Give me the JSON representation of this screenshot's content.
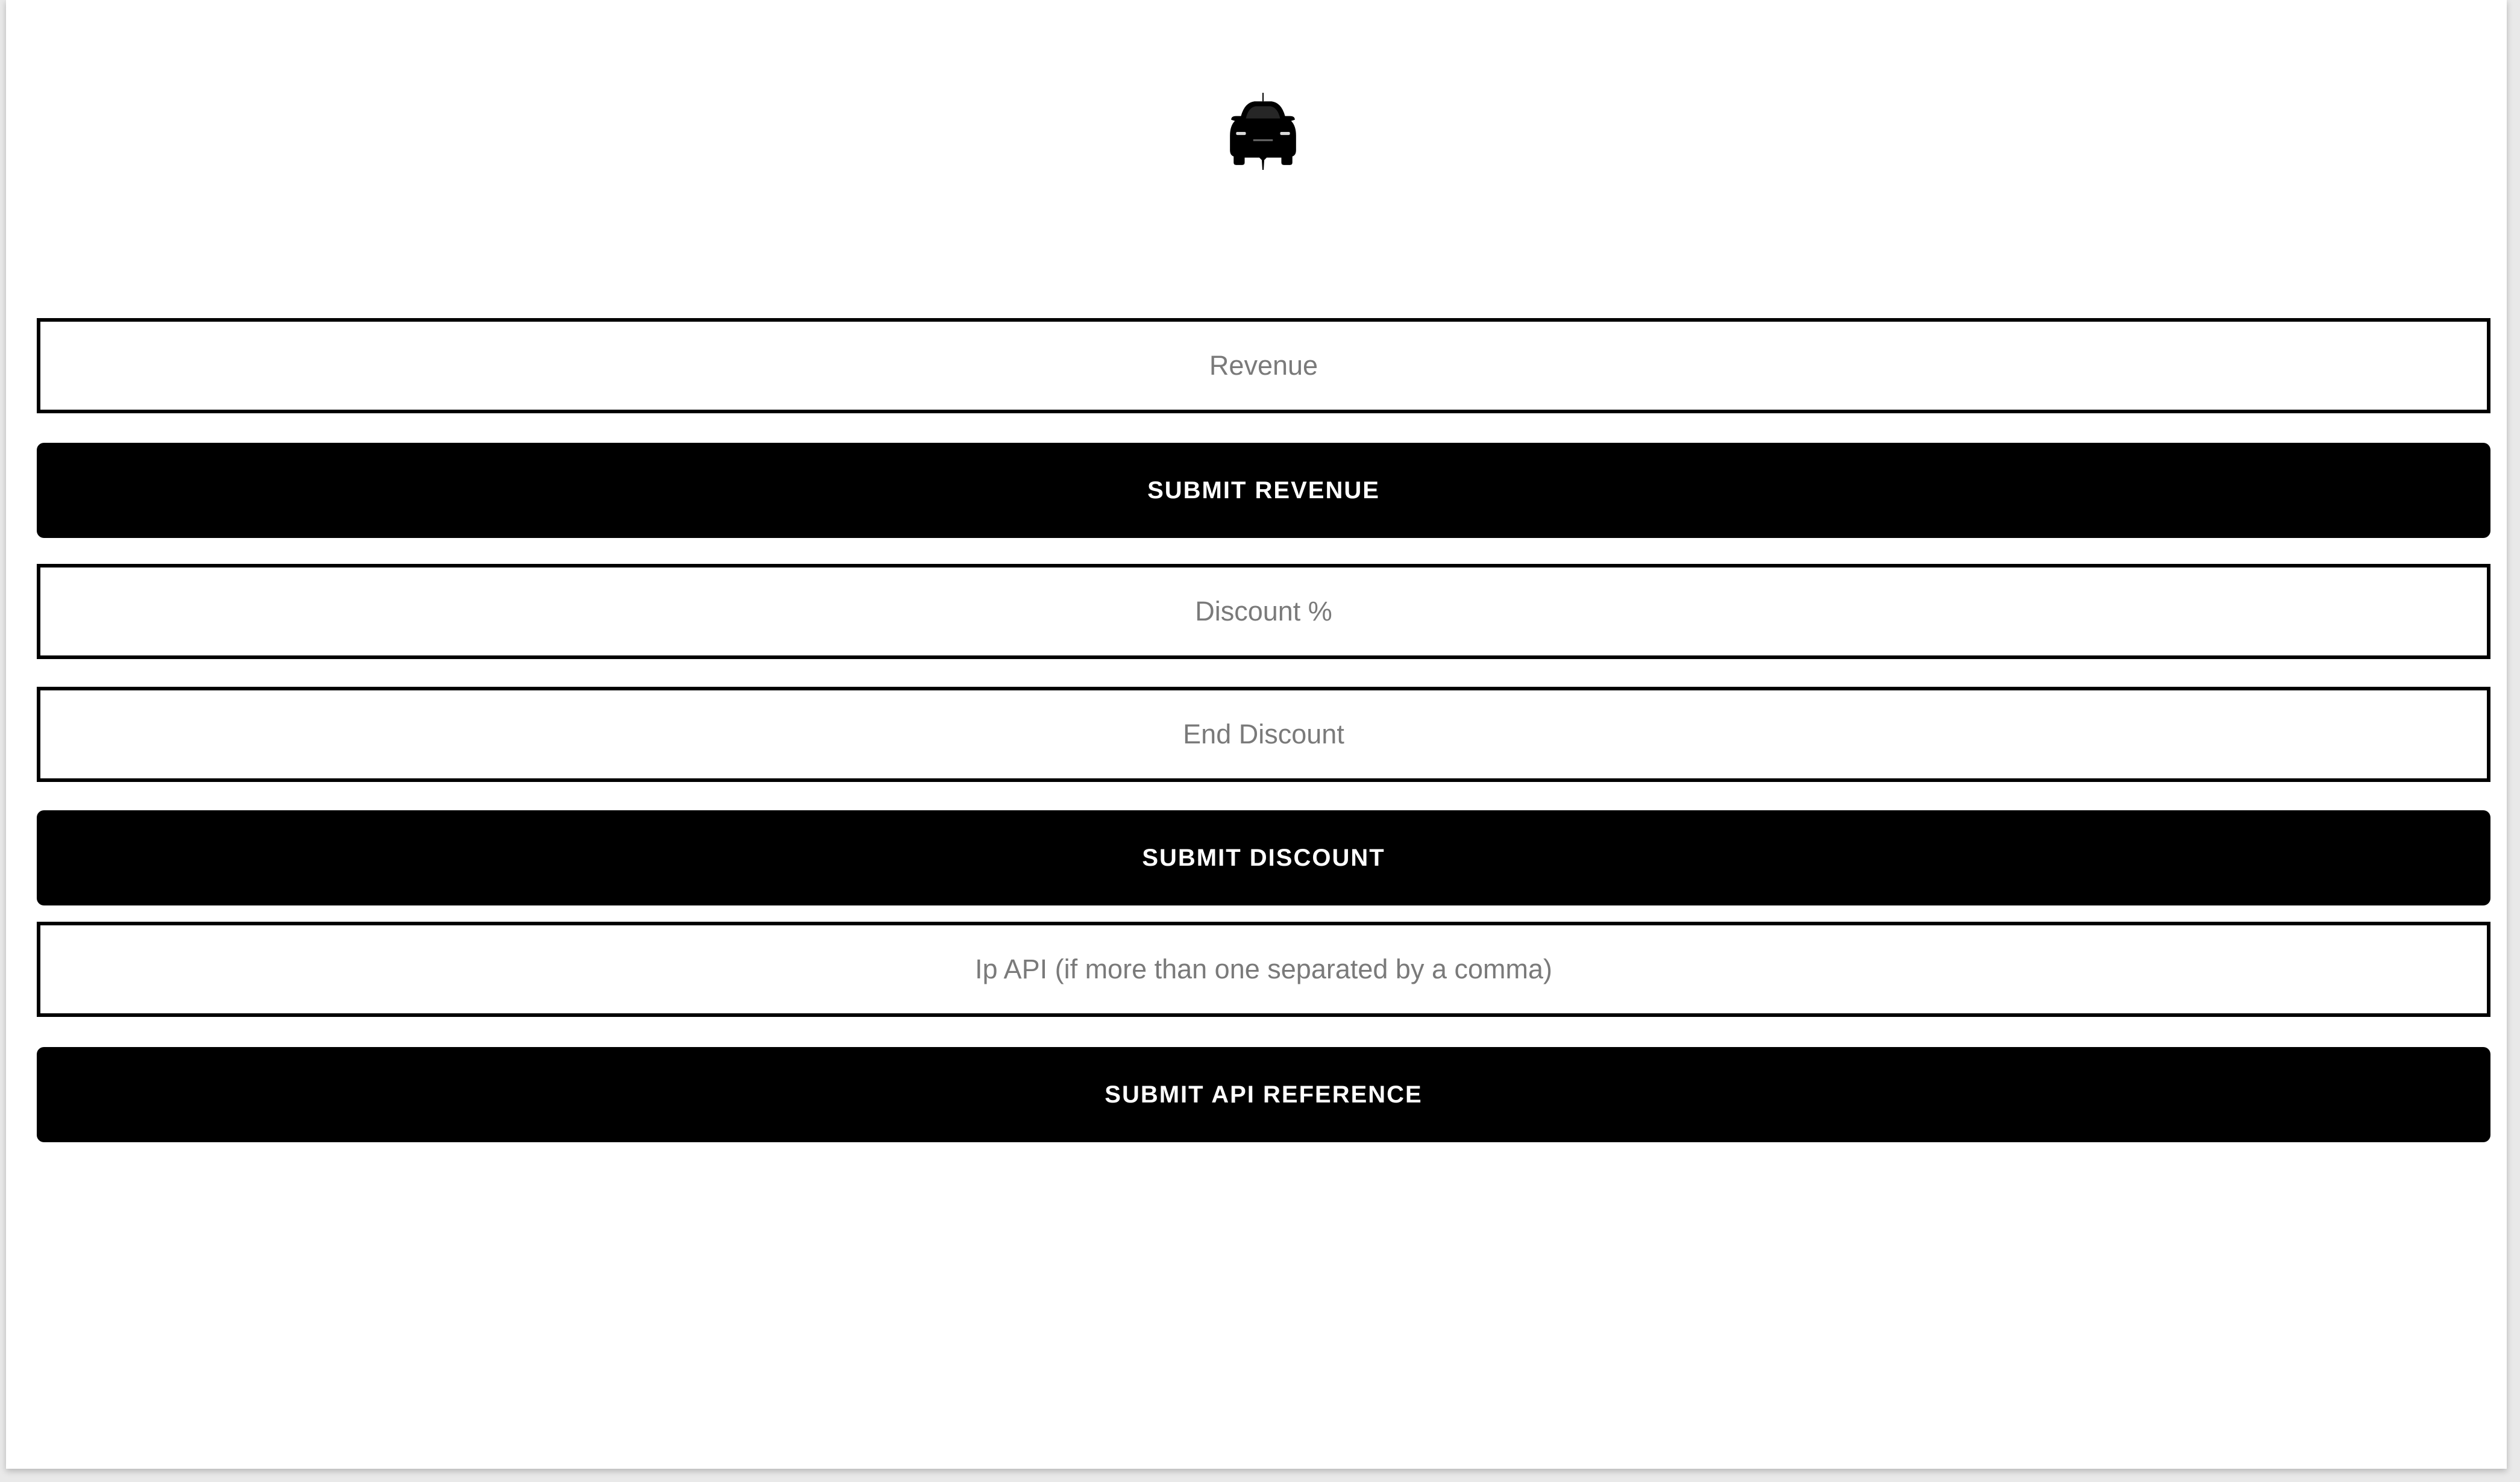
{
  "logo": {
    "icon": "car-icon",
    "color": "#000000"
  },
  "form": {
    "revenue": {
      "placeholder": "Revenue",
      "value": ""
    },
    "submit_revenue_label": "SUBMIT REVENUE",
    "discount": {
      "placeholder": "Discount %",
      "value": ""
    },
    "end_discount": {
      "placeholder": "End Discount",
      "value": ""
    },
    "submit_discount_label": "SUBMIT DISCOUNT",
    "ip_api": {
      "placeholder": "Ip API (if more than one separated by a comma)",
      "value": ""
    },
    "submit_api_label": "SUBMIT API REFERENCE"
  },
  "colors": {
    "button_bg": "#000000",
    "button_text": "#ffffff",
    "field_border": "#000000",
    "placeholder": "#7a7a7a",
    "background": "#ffffff"
  }
}
